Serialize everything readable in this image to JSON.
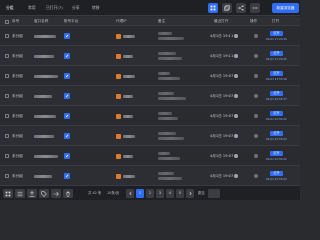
{
  "toolbar": {
    "tabs": [
      "分组",
      "常用",
      "已打开(7)",
      "分享",
      "转移"
    ],
    "main_button": "新建浏览器"
  },
  "table": {
    "headers": [
      "序号",
      "窗口名称",
      "账号平台",
      "代理IP",
      "备注",
      "最近打开",
      "操作",
      "打开"
    ]
  },
  "rows": [
    {
      "status": "未分组",
      "time": "4月1日 19:11",
      "open_label": "打开",
      "open_date": "04-01 17:20:45"
    },
    {
      "status": "未分组",
      "time": "4月1日 19:11",
      "open_label": "打开",
      "open_date": "04-01 17:20:45"
    },
    {
      "status": "未分组",
      "time": "4月1日 19:07",
      "open_label": "打开",
      "open_date": "04-01 23:55:58"
    },
    {
      "status": "未分组",
      "time": "4月1日 19:07",
      "open_label": "打开",
      "open_date": "04-01 23:55:37"
    },
    {
      "status": "未分组",
      "time": "4月1日 19:07",
      "open_label": "打开",
      "open_date": "04-01 22:55:22"
    },
    {
      "status": "未分组",
      "time": "4月1日 19:07",
      "open_label": "打开",
      "open_date": "04-01 22:55:02"
    },
    {
      "status": "未分组",
      "time": "4月1日 19:07",
      "open_label": "打开",
      "open_date": "04-01 22:55:22"
    },
    {
      "status": "未分组",
      "time": "4月1日 19:07",
      "open_label": "打开",
      "open_date": "04-01 22:55:02"
    }
  ],
  "footer": {
    "total": "共 42 条",
    "per_page": "10条/页",
    "pages": [
      "1",
      "2",
      "3",
      "4",
      "5"
    ],
    "goto": "跳至"
  }
}
